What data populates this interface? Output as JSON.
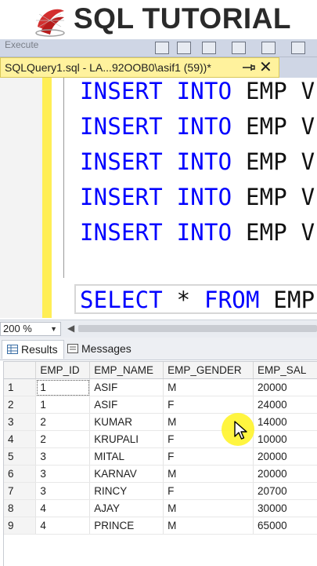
{
  "banner": {
    "title": "SQL TUTORIAL",
    "logo_icon": "sql-server-logo-icon"
  },
  "toolbar": {
    "text": "Execute"
  },
  "document_tab": {
    "title": "SQLQuery1.sql - LA...92OOB0\\asif1 (59))*",
    "close_label": "✕"
  },
  "editor": {
    "lines": [
      {
        "kw1": "INSERT",
        "kw2": "INTO",
        "rest": "EMP V"
      },
      {
        "kw1": "INSERT",
        "kw2": "INTO",
        "rest": "EMP V"
      },
      {
        "kw1": "INSERT",
        "kw2": "INTO",
        "rest": "EMP V"
      },
      {
        "kw1": "INSERT",
        "kw2": "INTO",
        "rest": "EMP V"
      },
      {
        "kw1": "INSERT",
        "kw2": "INTO",
        "rest": "EMP V"
      }
    ],
    "select_line": {
      "kw1": "SELECT",
      "star": "*",
      "kw2": "FROM",
      "rest": "EMP"
    }
  },
  "zoom": {
    "value": "200 %"
  },
  "results_tabs": {
    "results": "Results",
    "messages": "Messages"
  },
  "grid": {
    "columns": [
      "EMP_ID",
      "EMP_NAME",
      "EMP_GENDER",
      "EMP_SAL"
    ],
    "rows": [
      {
        "n": "1",
        "id": "1",
        "name": "ASIF",
        "gender": "M",
        "sal": "20000"
      },
      {
        "n": "2",
        "id": "1",
        "name": "ASIF",
        "gender": "F",
        "sal": "24000"
      },
      {
        "n": "3",
        "id": "2",
        "name": "KUMAR",
        "gender": "M",
        "sal": "14000"
      },
      {
        "n": "4",
        "id": "2",
        "name": "KRUPALI",
        "gender": "F",
        "sal": "10000"
      },
      {
        "n": "5",
        "id": "3",
        "name": "MITAL",
        "gender": "F",
        "sal": "20000"
      },
      {
        "n": "6",
        "id": "3",
        "name": "KARNAV",
        "gender": "M",
        "sal": "20000"
      },
      {
        "n": "7",
        "id": "3",
        "name": "RINCY",
        "gender": "F",
        "sal": "20700"
      },
      {
        "n": "8",
        "id": "4",
        "name": "AJAY",
        "gender": "M",
        "sal": "30000"
      },
      {
        "n": "9",
        "id": "4",
        "name": "PRINCE",
        "gender": "M",
        "sal": "65000"
      }
    ]
  },
  "colors": {
    "keyword": "#0000ff",
    "tab_active": "#fff29d",
    "change_bar": "#ffee55",
    "cursor_highlight": "#fff31e"
  }
}
